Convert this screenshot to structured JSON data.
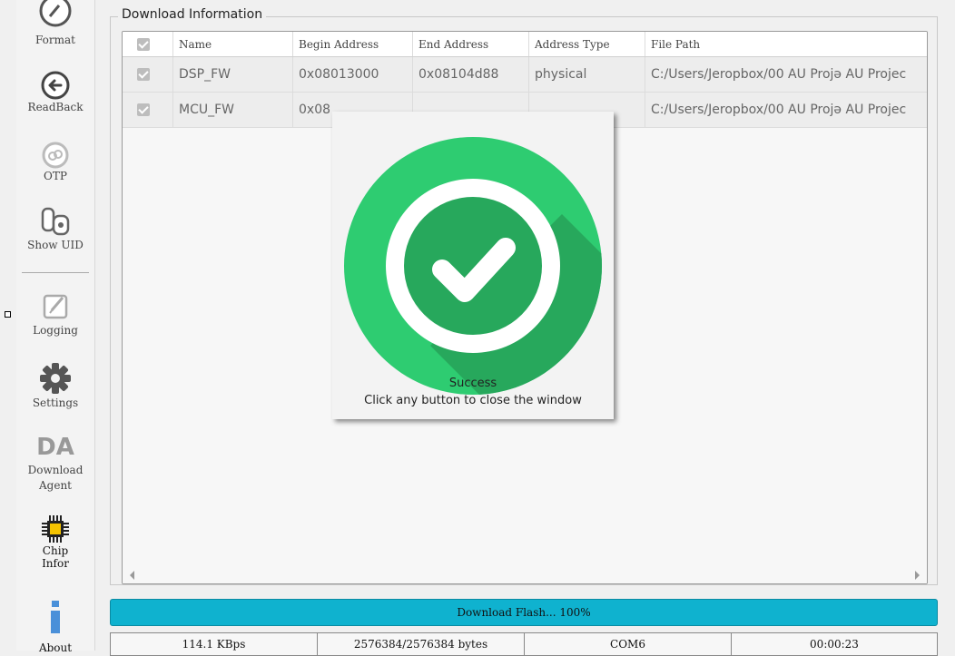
{
  "sidebar": {
    "items": [
      {
        "label": "Format",
        "icon": "format-icon"
      },
      {
        "label": "ReadBack",
        "icon": "readback-arrow-icon"
      },
      {
        "label": "OTP",
        "icon": "otp-icon"
      },
      {
        "label": "Show UID",
        "icon": "show-uid-icon"
      },
      {
        "label": "Logging",
        "icon": "logging-icon"
      },
      {
        "label": "Settings",
        "icon": "gear-icon"
      },
      {
        "label": "Download",
        "label2": "Agent",
        "icon_text": "DA",
        "icon": "download-agent-icon"
      },
      {
        "label": "Chip",
        "label2": "Infor",
        "icon": "chip-icon"
      },
      {
        "label": "About",
        "icon": "info-icon"
      }
    ]
  },
  "group_title": "Download Information",
  "table": {
    "columns": [
      "Name",
      "Begin Address",
      "End Address",
      "Address Type",
      "File Path"
    ],
    "rows": [
      {
        "name": "DSP_FW",
        "begin": "0x08013000",
        "end": "0x08104d88",
        "type": "physical",
        "path": "C:/Users/Jeropbox/00 AU Projə AU Projec"
      },
      {
        "name": "MCU_FW",
        "begin": "0x08",
        "end": "",
        "type": "",
        "path": "C:/Users/Jeropbox/00 AU Projə AU Projec"
      }
    ]
  },
  "popup": {
    "title": "Success",
    "subtitle": "Click any button to close the window"
  },
  "progress": {
    "label": "Download Flash... 100%",
    "percent": 100
  },
  "status": {
    "speed": "114.1 KBps",
    "bytes": "2576384/2576384 bytes",
    "port": "COM6",
    "time": "00:00:23"
  },
  "colors": {
    "progress": "#0fb2cf",
    "success_green": "#2ecc71",
    "success_dark": "#27a85c"
  }
}
